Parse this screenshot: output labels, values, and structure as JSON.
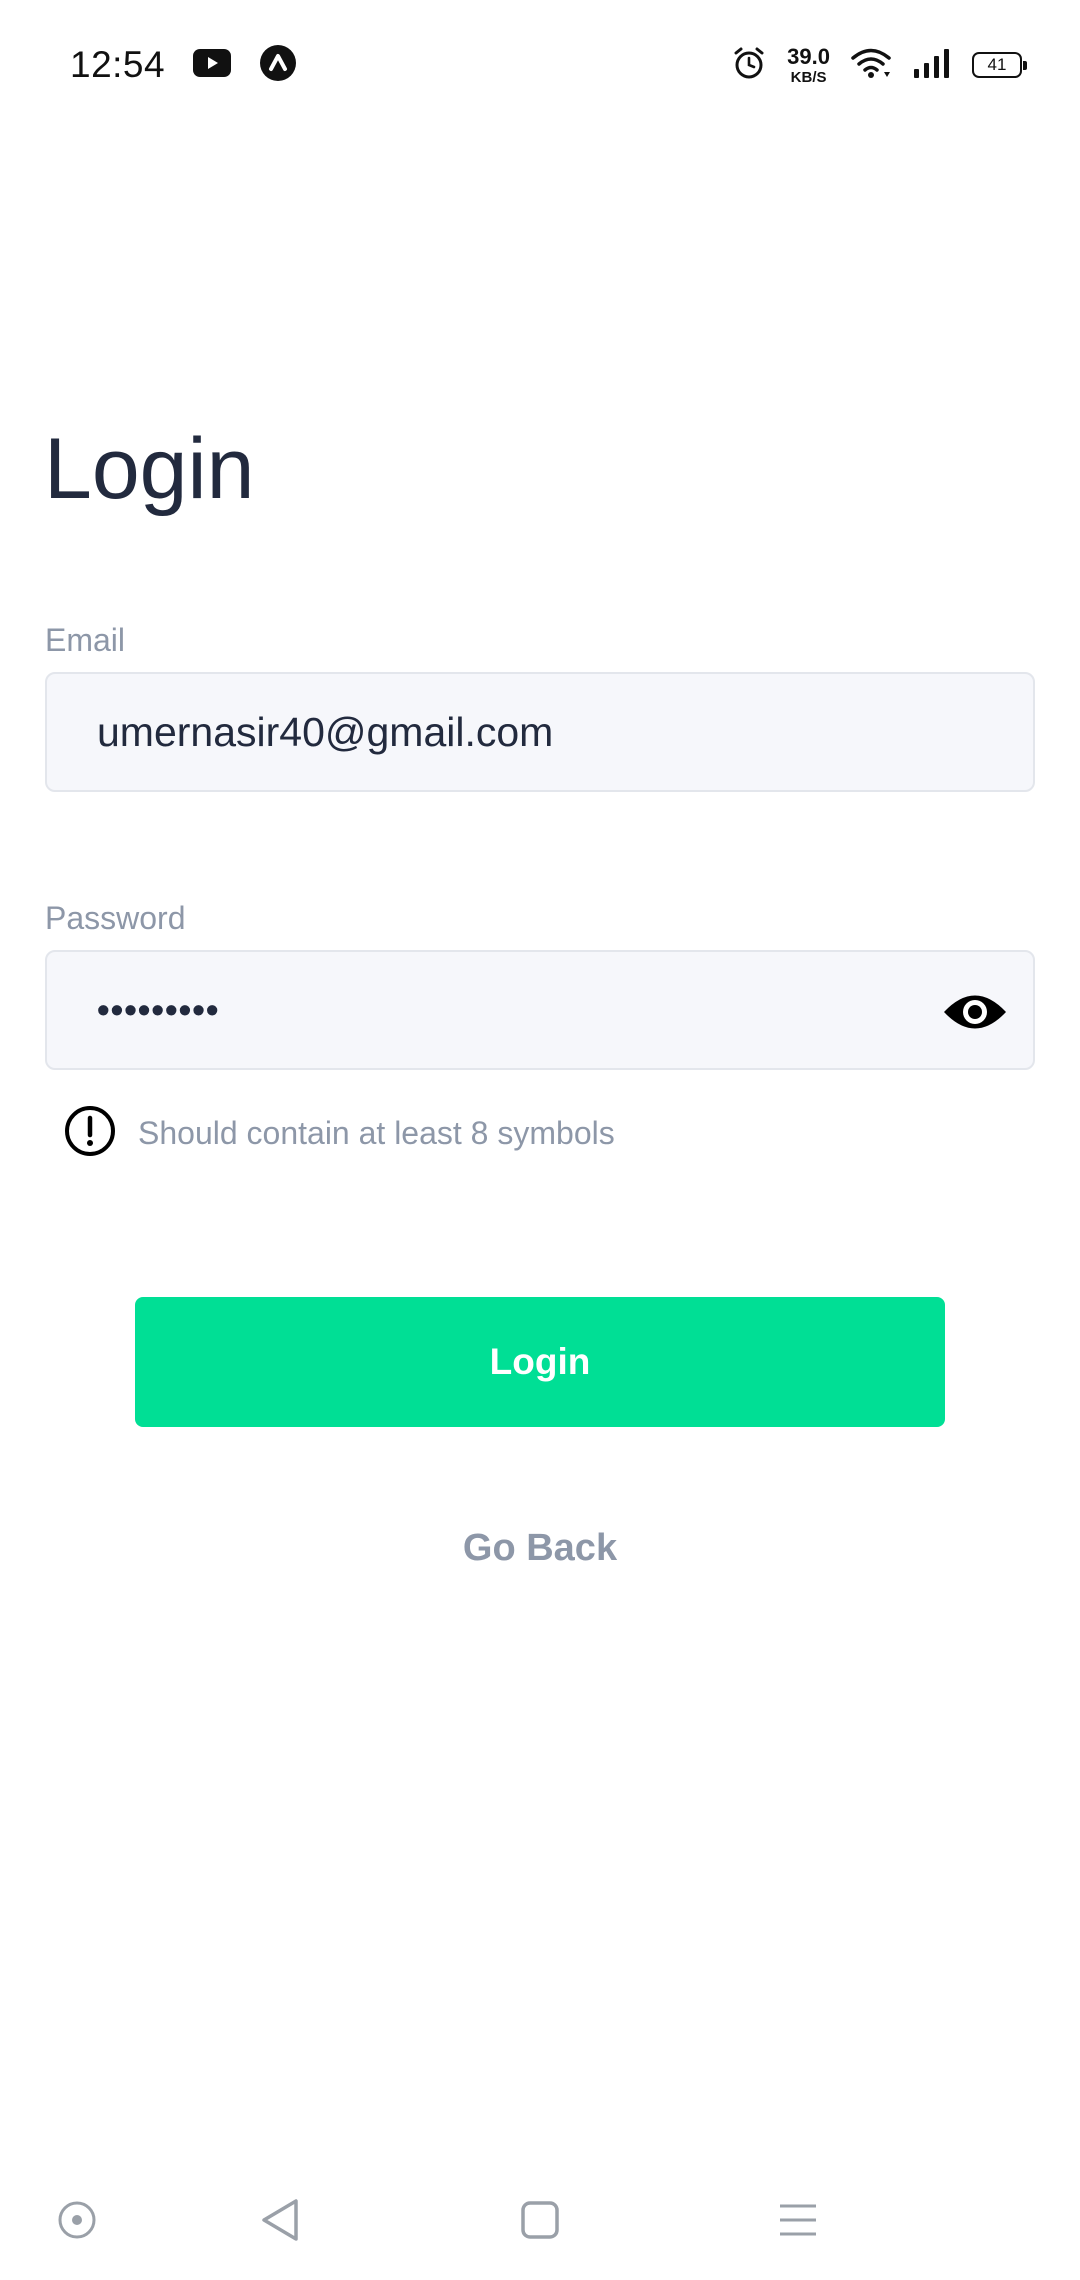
{
  "status_bar": {
    "time": "12:54",
    "net_speed_value": "39.0",
    "net_speed_unit": "KB/S",
    "battery_level": "41",
    "icons": [
      "youtube-icon",
      "app-a-icon",
      "alarm-icon",
      "wifi-icon",
      "signal-icon",
      "battery-icon"
    ]
  },
  "page": {
    "title": "Login"
  },
  "form": {
    "email_label": "Email",
    "email_value": "umernasir40@gmail.com",
    "password_label": "Password",
    "password_value": "•••••••••",
    "password_hint": "Should contain at least 8 symbols",
    "login_button": "Login",
    "go_back": "Go Back"
  },
  "nav_bar": {
    "items": [
      "home-circle-icon",
      "back-icon",
      "recents-icon",
      "menu-icon"
    ]
  },
  "colors": {
    "accent": "#00df95",
    "title": "#222a3e",
    "muted": "#8d97a8",
    "input_bg": "#f6f7fb"
  }
}
